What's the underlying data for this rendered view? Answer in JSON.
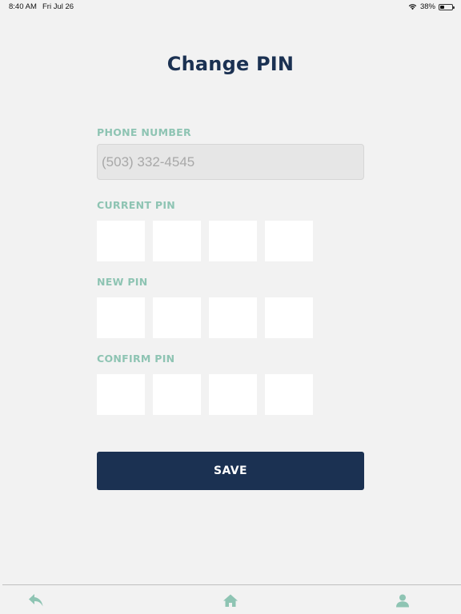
{
  "status_bar": {
    "time": "8:40 AM",
    "date": "Fri Jul 26",
    "battery_percent": "38%",
    "battery_level": 0.38
  },
  "page": {
    "title": "Change PIN"
  },
  "form": {
    "phone_label": "PHONE NUMBER",
    "phone_placeholder": "(503) 332-4545",
    "current_pin_label": "CURRENT PIN",
    "new_pin_label": "NEW PIN",
    "confirm_pin_label": "CONFIRM PIN",
    "save_label": "SAVE"
  },
  "bottom_nav": {
    "items": [
      {
        "icon": "reply-back-icon"
      },
      {
        "icon": "home-icon"
      },
      {
        "icon": "profile-icon"
      }
    ]
  },
  "colors": {
    "title": "#1b3152",
    "label": "#8ec4b3",
    "button_bg": "#1b3152",
    "nav_icon": "#8ec4b3",
    "background": "#f2f2f2"
  }
}
